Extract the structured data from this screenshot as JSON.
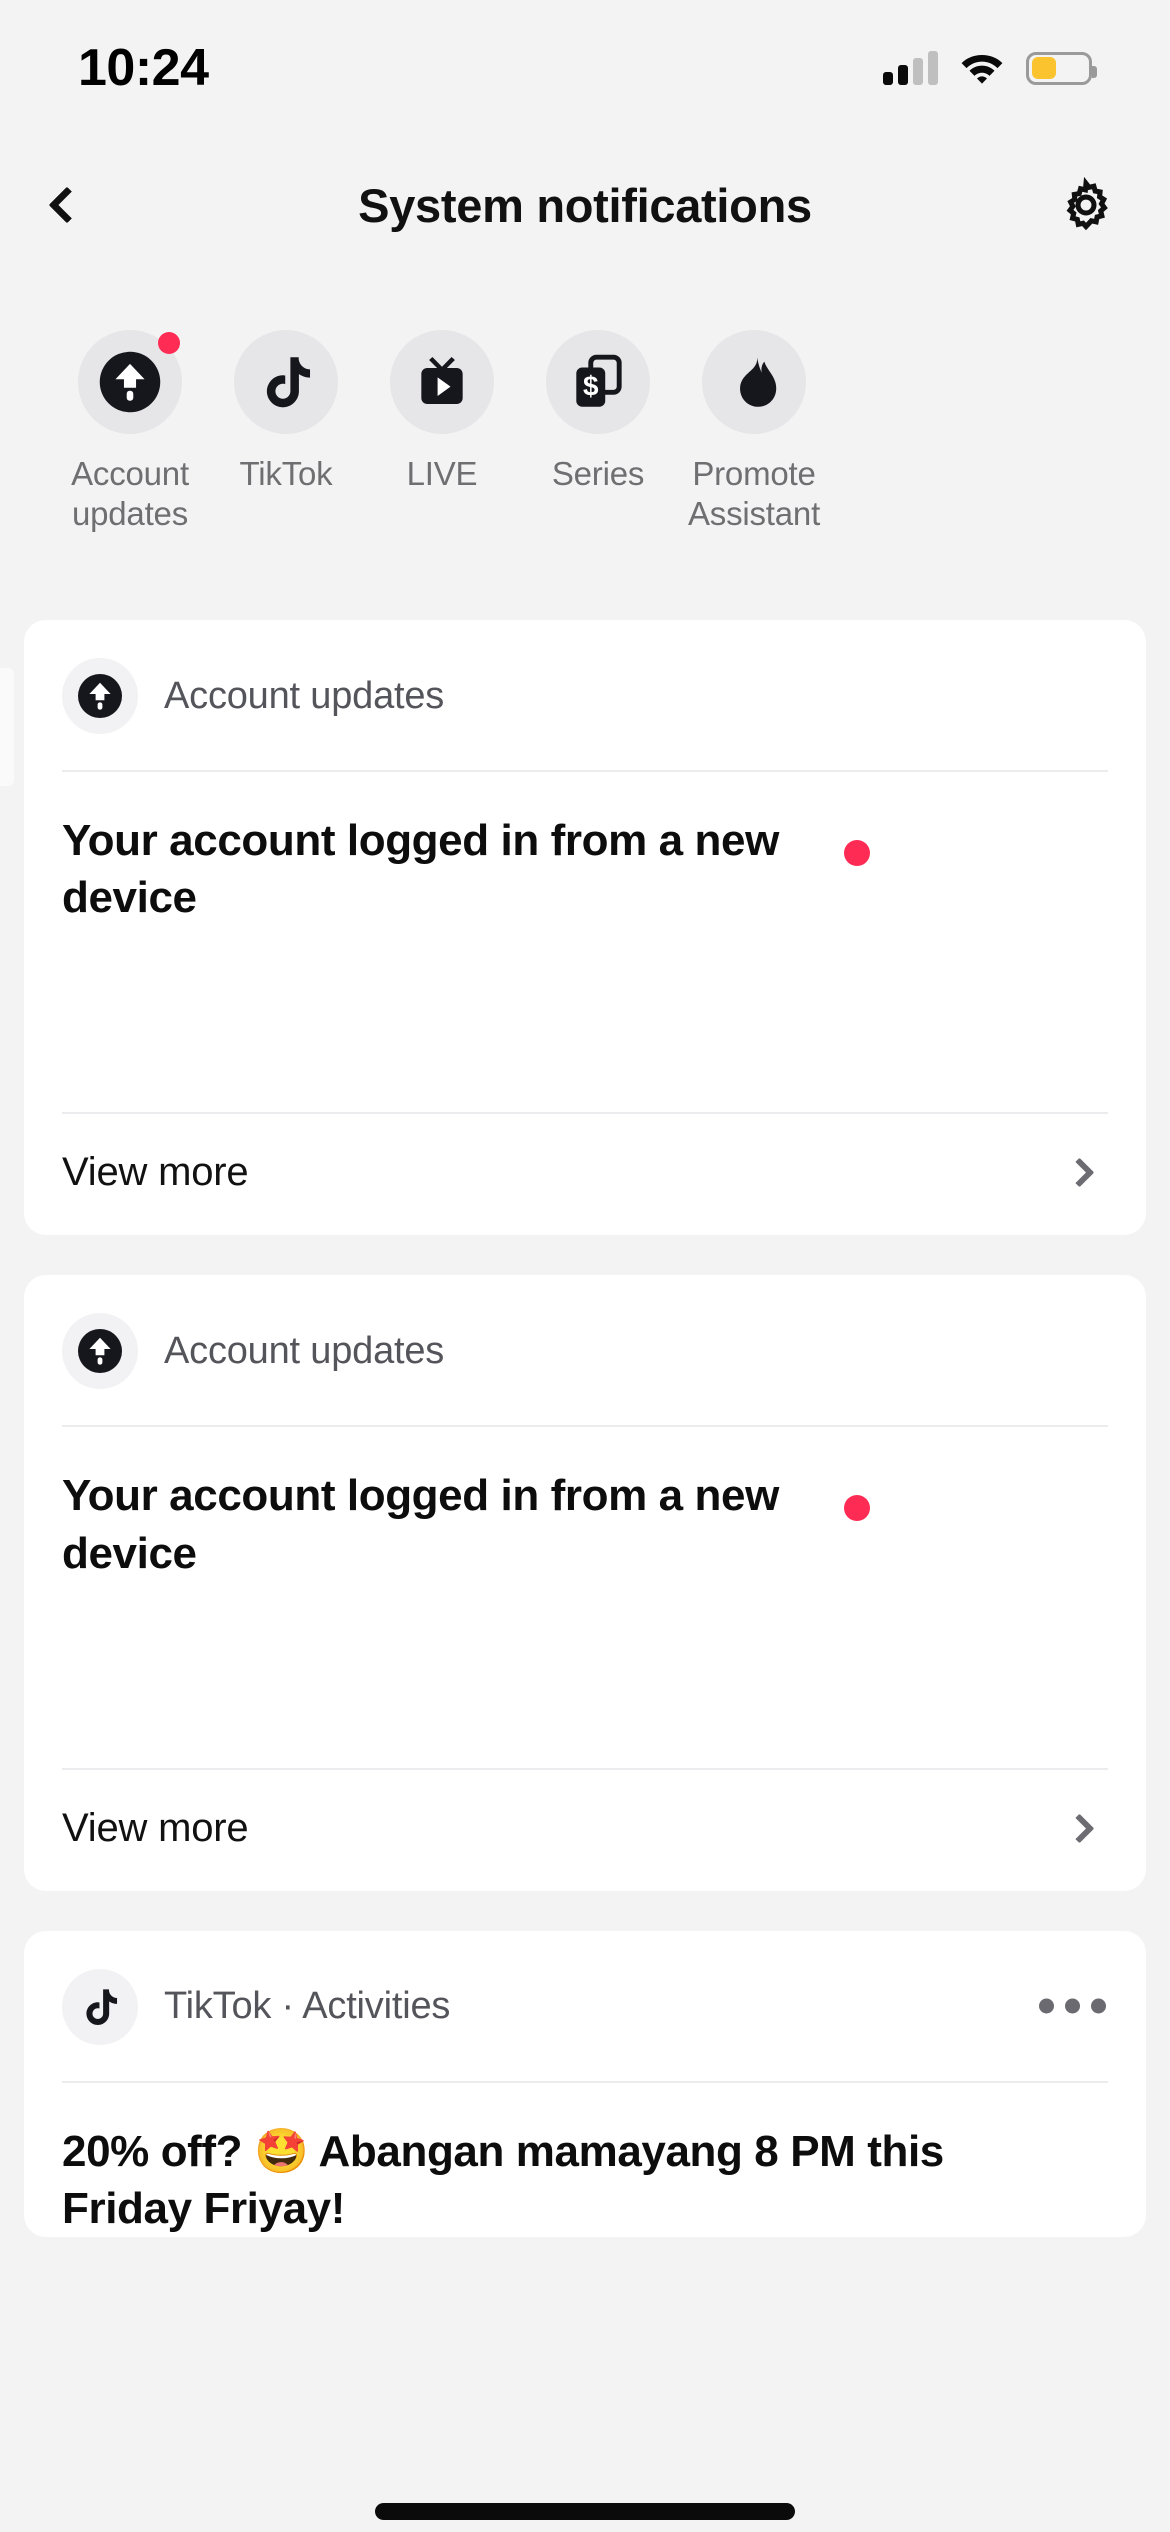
{
  "status_bar": {
    "time": "10:24",
    "signal_icon": "cellular-signal-icon",
    "signal_bars_filled": 2,
    "signal_bars_total": 4,
    "wifi_icon": "wifi-icon",
    "battery_icon": "battery-icon",
    "battery_level_percent": 45,
    "battery_color": "#FBC42F"
  },
  "header": {
    "back_icon": "chevron-left-icon",
    "title": "System notifications",
    "settings_icon": "gear-icon"
  },
  "categories": [
    {
      "label": "Account updates",
      "icon": "account-updates-arrow-up-icon",
      "badge": true
    },
    {
      "label": "TikTok",
      "icon": "tiktok-note-icon",
      "badge": false
    },
    {
      "label": "LIVE",
      "icon": "live-tv-icon",
      "badge": false
    },
    {
      "label": "Series",
      "icon": "series-dollar-card-icon",
      "badge": false
    },
    {
      "label": "Promote Assistant",
      "icon": "promote-flame-icon",
      "badge": false
    }
  ],
  "notifications": [
    {
      "source_icon": "account-updates-arrow-up-icon",
      "source": "Account updates",
      "title": "Your account logged in from a new device",
      "unread": true,
      "footer_label": "View more",
      "footer_icon": "chevron-right-icon",
      "has_more_menu": false
    },
    {
      "source_icon": "account-updates-arrow-up-icon",
      "source": "Account updates",
      "title": "Your account logged in from a new device",
      "unread": true,
      "footer_label": "View more",
      "footer_icon": "chevron-right-icon",
      "has_more_menu": false
    },
    {
      "source_icon": "tiktok-note-icon",
      "source": "TikTok · Activities",
      "title": "20% off? 🤩 Abangan mamayang 8 PM this Friday Friyay!",
      "unread": false,
      "footer_label": "",
      "footer_icon": "more-options-icon",
      "has_more_menu": true
    }
  ],
  "colors": {
    "page_background": "#F3F3F4",
    "card_background": "#FFFFFF",
    "accent_red": "#FE2C55",
    "muted_text": "#6F6F72",
    "primary_text": "#0D0D0D"
  }
}
